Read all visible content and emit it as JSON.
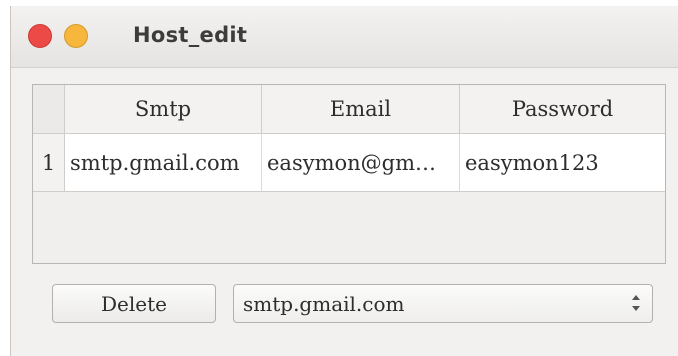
{
  "window": {
    "title": "Host_edit",
    "controls": [
      "close",
      "minimize"
    ]
  },
  "colors": {
    "close": "#ec4a47",
    "minimize": "#f6b73c"
  },
  "table": {
    "columns": [
      "Smtp",
      "Email",
      "Password"
    ],
    "rows": [
      {
        "index": "1",
        "smtp": "smtp.gmail.com",
        "email": "easymon@gm…",
        "password": "easymon123"
      }
    ]
  },
  "actions": {
    "delete_label": "Delete",
    "host_select": {
      "value": "smtp.gmail.com"
    }
  }
}
